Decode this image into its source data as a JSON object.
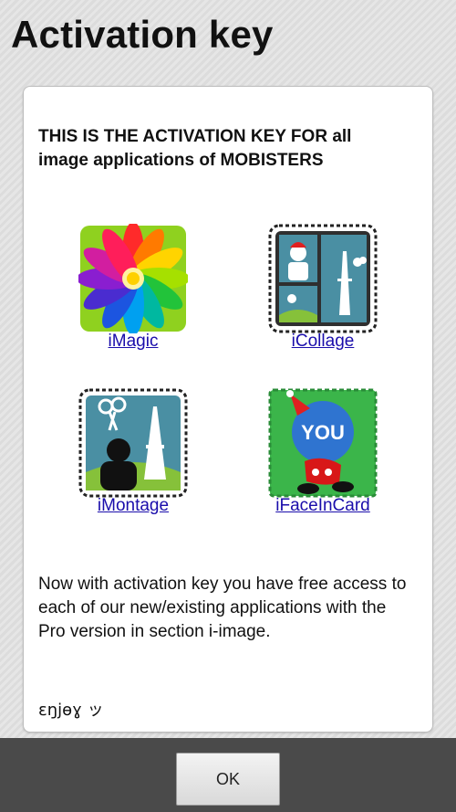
{
  "dialog": {
    "title": "Activation key",
    "heading": "THIS IS THE ACTIVATION KEY FOR all image applications of MOBISTERS",
    "apps": [
      {
        "label": "iMagic"
      },
      {
        "label": "iCollage"
      },
      {
        "label": "iMontage"
      },
      {
        "label": "iFaceInCard"
      }
    ],
    "icon_badge_text": "YOU",
    "body": "Now with activation key you have free access to each of our new/existing applications with the Pro version in section i-image.",
    "signoff": "ɛŋjѳɣ ッ",
    "ok_label": "OK"
  },
  "colors": {
    "link": "#1a0dab",
    "footer": "#4a4a4a",
    "imagic_bg": "#8fd11f",
    "icollage_bg": "#4a8fa3",
    "iface_bg": "#3bb54a"
  }
}
